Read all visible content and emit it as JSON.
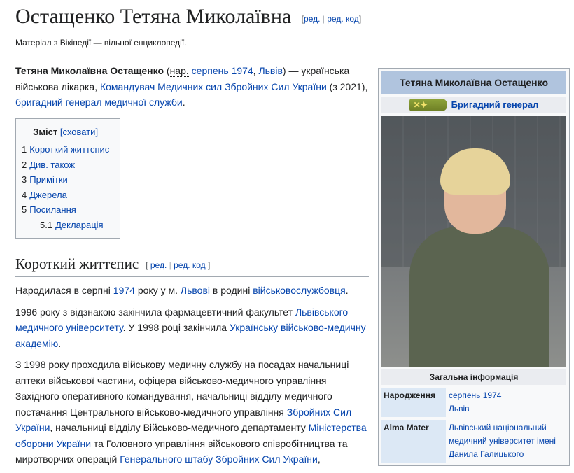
{
  "title": "Остащенко Тетяна Миколаївна",
  "edit": {
    "edit": "ред.",
    "edit_code": "ред. код",
    "sep": "|"
  },
  "tagline": "Матеріал з Вікіпедії — вільної енциклопедії.",
  "lead": {
    "name_bold": "Тетяна Миколаївна Остащенко",
    "p1": " (",
    "abbr": "нар.",
    "sp1": " ",
    "born_date": "серпень 1974",
    "comma1": ", ",
    "born_place": "Львів",
    "p2": ") — українська військова лікарка, ",
    "position": "Командувач Медичних сил Збройних Сил України",
    "p3": " (з 2021), ",
    "rank": "бригадний генерал медичної служби",
    "p4": "."
  },
  "toc": {
    "title": "Зміст",
    "hide": "[сховати]",
    "items": [
      {
        "num": "1",
        "label": "Короткий життєпис"
      },
      {
        "num": "2",
        "label": "Див. також"
      },
      {
        "num": "3",
        "label": "Примітки"
      },
      {
        "num": "4",
        "label": "Джерела"
      },
      {
        "num": "5",
        "label": "Посилання"
      }
    ],
    "sub": {
      "num": "5.1",
      "label": "Декларація"
    }
  },
  "section": {
    "heading": "Короткий життєпис",
    "bracket_open": "[ ",
    "bracket_close": " ]",
    "para1": {
      "a": "Народилася в серпні ",
      "year": "1974",
      "b": " року у м. ",
      "city": "Львові",
      "c": " в родині ",
      "family": "військовослужбовця",
      "d": "."
    },
    "para2": {
      "a": "1996 року з відзнакою закінчила фармацевтичний факультет ",
      "uni": "Львівського медичного університету",
      "b": ". У 1998 році закінчила ",
      "academy": "Українську військово-медичну академію",
      "c": "."
    },
    "para3": {
      "a": "З 1998 року проходила військову медичну службу на посадах начальниці аптеки військової частини, офіцера військово-медичного управління Західного оперативного командування, начальниці відділу медичного постачання Центрального військово-медичного управління ",
      "zsu": "Збройних Сил України",
      "b": ", начальниці відділу Військово-медичного департаменту ",
      "ministry": "Міністерства оборони України",
      "c": " та Головного управління військового співробітництва та миротворчих операцій ",
      "genstaff": "Генерального штабу Збройних Сил України",
      "d": ","
    }
  },
  "infobox": {
    "title": "Тетяна Миколаївна Остащенко",
    "rank": "Бригадний генерал",
    "section": "Загальна інформація",
    "birth_label": "Народження",
    "birth_date": "серпень 1974",
    "birth_place": "Львів",
    "alma_label": "Alma Mater",
    "alma_value": "Львівський національний медичний університет імені Данила Галицького"
  }
}
